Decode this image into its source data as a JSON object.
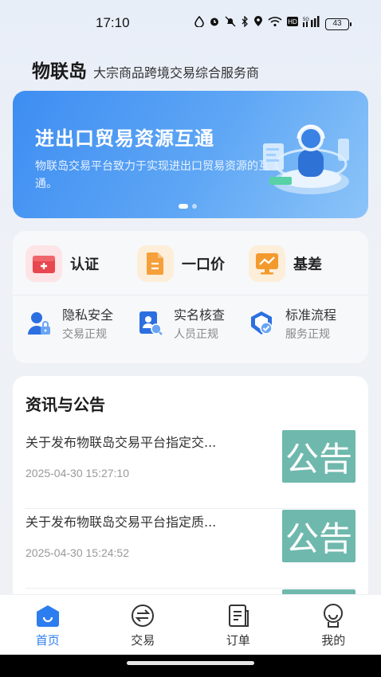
{
  "status_bar": {
    "time": "17:10",
    "battery": "43",
    "network": "5G"
  },
  "header": {
    "brand": "物联岛",
    "tagline": "大宗商品跨境交易综合服务商"
  },
  "banner": {
    "title": "进出口贸易资源互通",
    "subtitle": "物联岛交易平台致力于实现进出口贸易资源的互通。",
    "slide_count": 2,
    "active_slide": 1
  },
  "features": {
    "primary": [
      {
        "label": "认证",
        "icon": "certification-icon",
        "color": "#e8474f"
      },
      {
        "label": "一口价",
        "icon": "fixed-price-icon",
        "color": "#f5a03a"
      },
      {
        "label": "基差",
        "icon": "basis-chart-icon",
        "color": "#f39a2f"
      }
    ],
    "secondary": [
      {
        "title": "隐私安全",
        "subtitle": "交易正规",
        "icon": "privacy-user-icon"
      },
      {
        "title": "实名核查",
        "subtitle": "人员正规",
        "icon": "id-check-icon"
      },
      {
        "title": "标准流程",
        "subtitle": "服务正规",
        "icon": "standard-process-icon"
      }
    ]
  },
  "news": {
    "title": "资讯与公告",
    "items": [
      {
        "headline": "关于发布物联岛交易平台指定交...",
        "date": "2025-04-30 15:27:10",
        "badge": "公告"
      },
      {
        "headline": "关于发布物联岛交易平台指定质...",
        "date": "2025-04-30 15:24:52",
        "badge": "公告"
      }
    ]
  },
  "tabbar": {
    "tabs": [
      {
        "label": "首页",
        "icon": "home-icon",
        "active": true
      },
      {
        "label": "交易",
        "icon": "exchange-icon",
        "active": false
      },
      {
        "label": "订单",
        "icon": "order-icon",
        "active": false
      },
      {
        "label": "我的",
        "icon": "profile-icon",
        "active": false
      }
    ]
  },
  "colors": {
    "accent": "#2c7df0",
    "badge_bg": "#6fb8ad"
  }
}
